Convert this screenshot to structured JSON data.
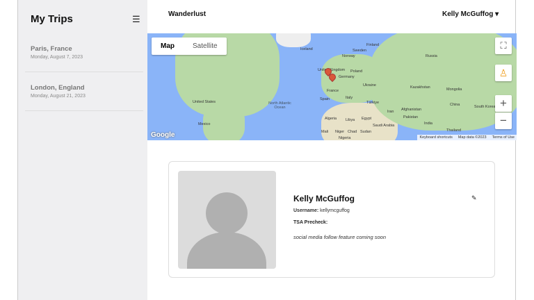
{
  "sidebar": {
    "title": "My Trips",
    "menu_icon": "hamburger-icon",
    "trips": [
      {
        "name": "Paris, France",
        "date": "Monday, August 7, 2023"
      },
      {
        "name": "London, England",
        "date": "Monday, August 21, 2023"
      }
    ]
  },
  "header": {
    "brand": "Wanderlust",
    "user": "Kelly McGuffog ▾"
  },
  "map": {
    "types": [
      "Map",
      "Satellite"
    ],
    "selected": "Map",
    "fullscreen": "⛶",
    "zoom_in": "+",
    "zoom_out": "−",
    "logo": "Google",
    "attribution": [
      "Keyboard shortcuts",
      "Map data ©2023",
      "Terms of Use"
    ],
    "labels": [
      "Iceland",
      "Sweden",
      "Finland",
      "Norway",
      "Russia",
      "United Kingdom",
      "Germany",
      "Poland",
      "Ukraine",
      "France",
      "Spain",
      "Italy",
      "Kazakhstan",
      "Mongolia",
      "China",
      "South Korea",
      "Türkiye",
      "Iran",
      "Afghanistan",
      "Pakistan",
      "India",
      "Thailand",
      "Algeria",
      "Libya",
      "Egypt",
      "Saudi Arabia",
      "Mali",
      "Niger",
      "Chad",
      "Sudan",
      "Nigeria",
      "United States",
      "Mexico",
      "North Atlantic Ocean"
    ]
  },
  "profile": {
    "name": "Kelly McGuffog",
    "username_label": "Username:",
    "username": "kellymcguffog",
    "tsa_label": "TSA Precheck:",
    "social": "social media follow feature coming soon"
  },
  "colors": {
    "sidebar_bg": "#efeff1",
    "water": "#8ab4f8",
    "land": "#b8d9a6",
    "pin": "#d9573a"
  }
}
